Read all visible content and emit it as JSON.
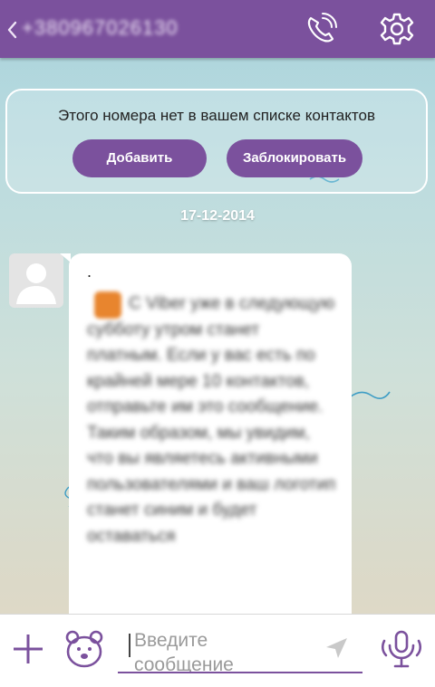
{
  "header": {
    "phone_number": "+380967026130",
    "icons": {
      "back": "chevron-left-icon",
      "call": "phone-call-icon",
      "settings": "gear-icon"
    }
  },
  "banner": {
    "message": "Этого номера нет в вашем списке контактов",
    "add_label": "Добавить",
    "block_label": "Заблокировать"
  },
  "chat": {
    "date": "17-12-2014",
    "message": {
      "prefix": ".",
      "text": "С Viber уже в следующую субботу утром станет платным. Если у вас есть по крайней мере 10 контактов, отправьте им это сообщение. Таким образом, мы увидим, что вы являетесь активными пользователями и ваш логотип станет синим и будет оставаться"
    }
  },
  "composer": {
    "placeholder": "Введите сообщение",
    "icons": {
      "attach": "plus-icon",
      "sticker": "bear-sticker-icon",
      "send": "send-arrow-icon",
      "voice": "microphone-icon"
    }
  },
  "colors": {
    "accent": "#7b519d",
    "header": "#7b519d",
    "bubble": "#ffffff"
  }
}
